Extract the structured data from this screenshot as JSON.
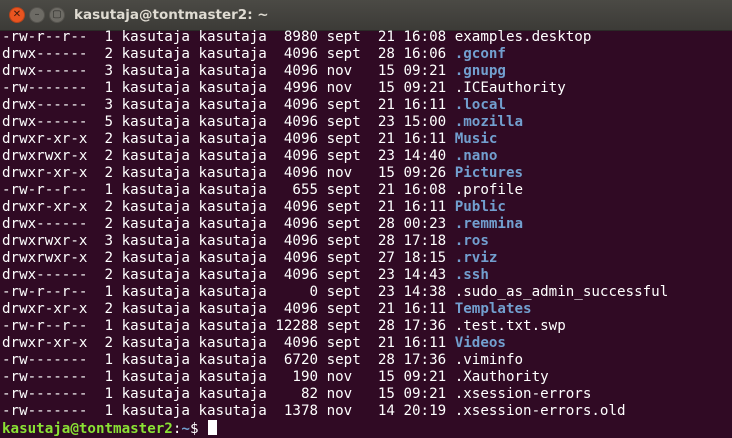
{
  "window": {
    "title": "kasutaja@tontmaster2: ~",
    "close_glyph": "✕",
    "minimize_glyph": "–",
    "maximize_glyph": "▢"
  },
  "colors": {
    "background": "#300a24",
    "text": "#ffffff",
    "directory": "#729fcf",
    "prompt_user": "#8ae234",
    "prompt_path": "#729fcf",
    "close_button": "#e95420"
  },
  "listing": [
    {
      "prefix": "-rw-r--r--  1 kasutaja kasutaja  8980 sept  21 16:08 ",
      "name": "examples.desktop",
      "is_dir": false
    },
    {
      "prefix": "drwx------  2 kasutaja kasutaja  4096 sept  28 16:06 ",
      "name": ".gconf",
      "is_dir": true
    },
    {
      "prefix": "drwx------  3 kasutaja kasutaja  4096 nov   15 09:21 ",
      "name": ".gnupg",
      "is_dir": true
    },
    {
      "prefix": "-rw-------  1 kasutaja kasutaja  4996 nov   15 09:21 ",
      "name": ".ICEauthority",
      "is_dir": false
    },
    {
      "prefix": "drwx------  3 kasutaja kasutaja  4096 sept  21 16:11 ",
      "name": ".local",
      "is_dir": true
    },
    {
      "prefix": "drwx------  5 kasutaja kasutaja  4096 sept  23 15:00 ",
      "name": ".mozilla",
      "is_dir": true
    },
    {
      "prefix": "drwxr-xr-x  2 kasutaja kasutaja  4096 sept  21 16:11 ",
      "name": "Music",
      "is_dir": true
    },
    {
      "prefix": "drwxrwxr-x  2 kasutaja kasutaja  4096 sept  23 14:40 ",
      "name": ".nano",
      "is_dir": true
    },
    {
      "prefix": "drwxr-xr-x  2 kasutaja kasutaja  4096 nov   15 09:26 ",
      "name": "Pictures",
      "is_dir": true
    },
    {
      "prefix": "-rw-r--r--  1 kasutaja kasutaja   655 sept  21 16:08 ",
      "name": ".profile",
      "is_dir": false
    },
    {
      "prefix": "drwxr-xr-x  2 kasutaja kasutaja  4096 sept  21 16:11 ",
      "name": "Public",
      "is_dir": true
    },
    {
      "prefix": "drwx------  2 kasutaja kasutaja  4096 sept  28 00:23 ",
      "name": ".remmina",
      "is_dir": true
    },
    {
      "prefix": "drwxrwxr-x  3 kasutaja kasutaja  4096 sept  28 17:18 ",
      "name": ".ros",
      "is_dir": true
    },
    {
      "prefix": "drwxrwxr-x  2 kasutaja kasutaja  4096 sept  27 18:15 ",
      "name": ".rviz",
      "is_dir": true
    },
    {
      "prefix": "drwx------  2 kasutaja kasutaja  4096 sept  23 14:43 ",
      "name": ".ssh",
      "is_dir": true
    },
    {
      "prefix": "-rw-r--r--  1 kasutaja kasutaja     0 sept  23 14:38 ",
      "name": ".sudo_as_admin_successful",
      "is_dir": false
    },
    {
      "prefix": "drwxr-xr-x  2 kasutaja kasutaja  4096 sept  21 16:11 ",
      "name": "Templates",
      "is_dir": true
    },
    {
      "prefix": "-rw-r--r--  1 kasutaja kasutaja 12288 sept  28 17:36 ",
      "name": ".test.txt.swp",
      "is_dir": false
    },
    {
      "prefix": "drwxr-xr-x  2 kasutaja kasutaja  4096 sept  21 16:11 ",
      "name": "Videos",
      "is_dir": true
    },
    {
      "prefix": "-rw-------  1 kasutaja kasutaja  6720 sept  28 17:36 ",
      "name": ".viminfo",
      "is_dir": false
    },
    {
      "prefix": "-rw-------  1 kasutaja kasutaja   190 nov   15 09:21 ",
      "name": ".Xauthority",
      "is_dir": false
    },
    {
      "prefix": "-rw-------  1 kasutaja kasutaja    82 nov   15 09:21 ",
      "name": ".xsession-errors",
      "is_dir": false
    },
    {
      "prefix": "-rw-------  1 kasutaja kasutaja  1378 nov   14 20:19 ",
      "name": ".xsession-errors.old",
      "is_dir": false
    }
  ],
  "prompt": {
    "user_host": "kasutaja@tontmaster2",
    "separator": ":",
    "path": "~",
    "symbol": "$ "
  }
}
